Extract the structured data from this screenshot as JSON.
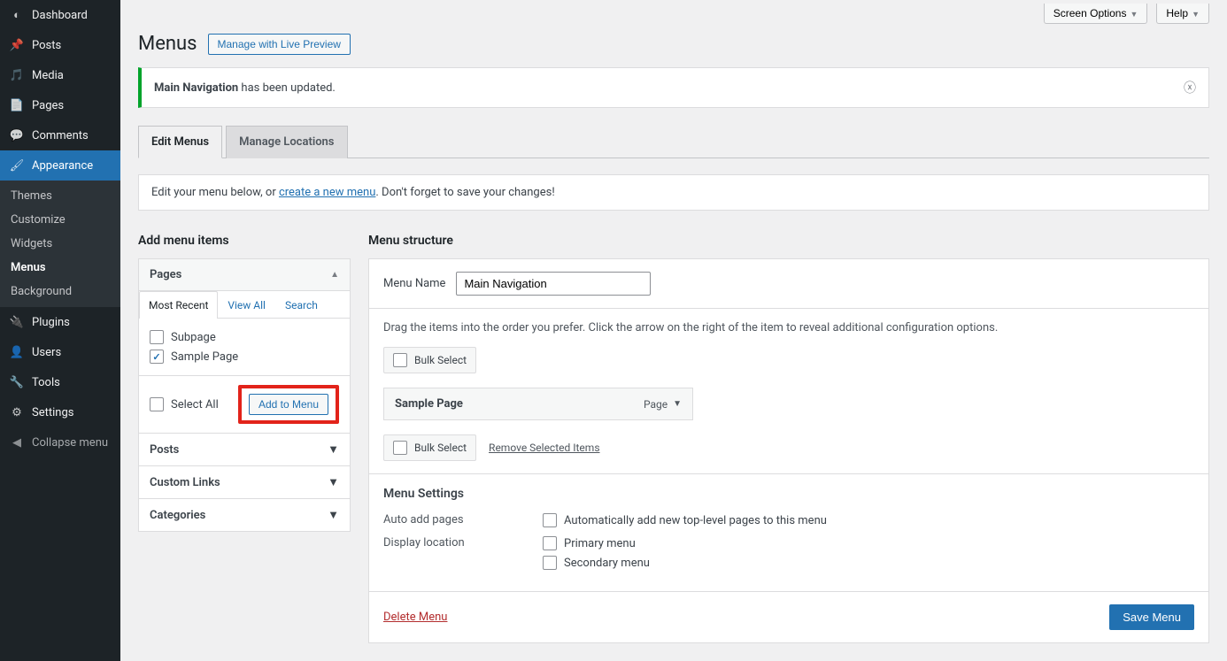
{
  "sidebar": {
    "items": [
      {
        "icon": "dashboard",
        "label": "Dashboard"
      },
      {
        "icon": "pin",
        "label": "Posts"
      },
      {
        "icon": "media",
        "label": "Media"
      },
      {
        "icon": "page",
        "label": "Pages"
      },
      {
        "icon": "comment",
        "label": "Comments"
      },
      {
        "icon": "brush",
        "label": "Appearance"
      },
      {
        "icon": "plugin",
        "label": "Plugins"
      },
      {
        "icon": "user",
        "label": "Users"
      },
      {
        "icon": "tool",
        "label": "Tools"
      },
      {
        "icon": "settings",
        "label": "Settings"
      }
    ],
    "submenu": [
      "Themes",
      "Customize",
      "Widgets",
      "Menus",
      "Background"
    ],
    "collapse": "Collapse menu"
  },
  "topbar": {
    "screen_options": "Screen Options",
    "help": "Help"
  },
  "header": {
    "title": "Menus",
    "preview_btn": "Manage with Live Preview"
  },
  "notice": {
    "strong": "Main Navigation",
    "rest": " has been updated."
  },
  "tabs": {
    "edit": "Edit Menus",
    "locations": "Manage Locations"
  },
  "infobox": {
    "before": "Edit your menu below, or ",
    "link": "create a new menu",
    "after": ". Don't forget to save your changes!"
  },
  "left": {
    "heading": "Add menu items",
    "pages": {
      "title": "Pages",
      "subtabs": {
        "recent": "Most Recent",
        "all": "View All",
        "search": "Search"
      },
      "items": [
        {
          "label": "Subpage",
          "checked": false
        },
        {
          "label": "Sample Page",
          "checked": true
        }
      ],
      "select_all": "Select All",
      "add_btn": "Add to Menu"
    },
    "posts": "Posts",
    "custom": "Custom Links",
    "categories": "Categories"
  },
  "right": {
    "heading": "Menu structure",
    "name_label": "Menu Name",
    "name_value": "Main Navigation",
    "instructions": "Drag the items into the order you prefer. Click the arrow on the right of the item to reveal additional configuration options.",
    "bulk": "Bulk Select",
    "item": {
      "title": "Sample Page",
      "type": "Page"
    },
    "remove": "Remove Selected Items",
    "settings": {
      "heading": "Menu Settings",
      "auto_label": "Auto add pages",
      "auto_opt": "Automatically add new top-level pages to this menu",
      "loc_label": "Display location",
      "loc_opts": [
        "Primary menu",
        "Secondary menu"
      ]
    },
    "delete": "Delete Menu",
    "save": "Save Menu"
  }
}
